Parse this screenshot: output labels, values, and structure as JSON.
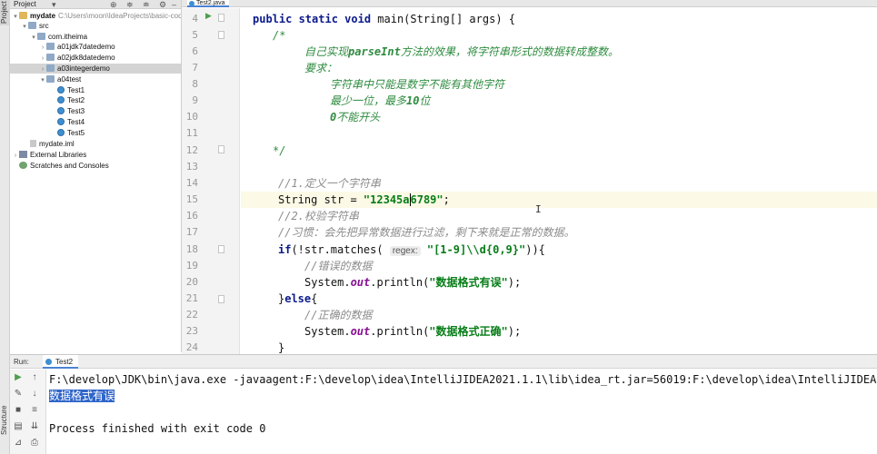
{
  "left_strip": {
    "project_label": "Project",
    "structure_label": "Structure"
  },
  "project_panel": {
    "title": "Project",
    "tree": [
      {
        "label": "mydate",
        "path": "C:\\Users\\moon\\IdeaProjects\\basic-code",
        "bold": true
      },
      {
        "label": "src"
      },
      {
        "label": "com.itheima"
      },
      {
        "label": "a01jdk7datedemo"
      },
      {
        "label": "a02jdk8datedemo"
      },
      {
        "label": "a03integerdemo"
      },
      {
        "label": "a04test"
      },
      {
        "label": "Test1"
      },
      {
        "label": "Test2"
      },
      {
        "label": "Test3"
      },
      {
        "label": "Test4"
      },
      {
        "label": "Test5"
      },
      {
        "label": "mydate.iml"
      },
      {
        "label": "External Libraries"
      },
      {
        "label": "Scratches and Consoles"
      }
    ]
  },
  "editor": {
    "tab_label": "Test2.java",
    "line_numbers": [
      "4",
      "5",
      "6",
      "7",
      "8",
      "9",
      "10",
      "11",
      "12",
      "13",
      "14",
      "15",
      "16",
      "17",
      "18",
      "19",
      "20",
      "21",
      "22",
      "23",
      "24"
    ],
    "code": {
      "l4_kw": "public static void",
      "l4_rest": " main(String[] args) {",
      "l5": "/*",
      "l6_a": "自己实现",
      "l6_b": "parseInt",
      "l6_c": "方法的效果，将字符串形式的数据转成整数。",
      "l7": "要求：",
      "l8": "字符串中只能是数字不能有其他字符",
      "l9_a": "最少一位，最多",
      "l9_b": "10",
      "l9_c": "位",
      "l10_a": "0",
      "l10_b": "不能开头",
      "l12": "*/",
      "l14": "//1.定义一个字符串",
      "l15_a": "String str = ",
      "l15_str_a": "\"12345a",
      "l15_str_b": "6789\"",
      "l15_end": ";",
      "l16": "//2.校验字符串",
      "l17": "//习惯：会先把异常数据进行过滤，剩下来就是正常的数据。",
      "l18_kw": "if",
      "l18_a": "(!str.matches( ",
      "l18_hint": "regex:",
      "l18_str": " \"[1-9]\\\\d{0,9}\"",
      "l18_b": ")){",
      "l19": "//错误的数据",
      "l20_a": "System.",
      "l20_out": "out",
      "l20_b": ".println(",
      "l20_str": "\"数据格式有误\"",
      "l20_c": ");",
      "l21_a": "}",
      "l21_kw": "else",
      "l21_b": "{",
      "l22": "//正确的数据",
      "l23_a": "System.",
      "l23_out": "out",
      "l23_b": ".println(",
      "l23_str": "\"数据格式正确\"",
      "l23_c": ");",
      "l24": "}"
    }
  },
  "run_panel": {
    "label": "Run:",
    "tab_label": "Test2",
    "console": [
      "F:\\develop\\JDK\\bin\\java.exe -javaagent:F:\\develop\\idea\\IntelliJIDEA2021.1.1\\lib\\idea_rt.jar=56019:F:\\develop\\idea\\IntelliJIDEA2021",
      "数据格式有误",
      "",
      "Process finished with exit code 0"
    ]
  },
  "colors": {
    "keyword": "#0b1a8c",
    "string": "#067d17",
    "comment": "#8c8c8c",
    "doc_comment": "#2f8c40",
    "selection": "#2f65ca"
  }
}
